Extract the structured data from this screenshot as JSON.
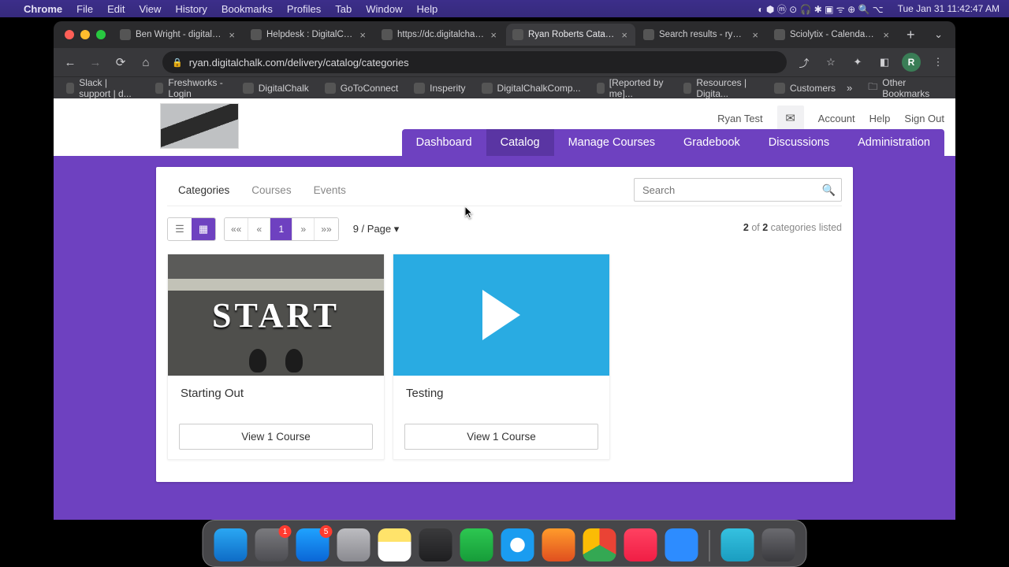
{
  "menubar": {
    "app": "Chrome",
    "items": [
      "File",
      "Edit",
      "View",
      "History",
      "Bookmarks",
      "Profiles",
      "Tab",
      "Window",
      "Help"
    ],
    "clock": "Tue Jan 31  11:42:47 AM"
  },
  "browser": {
    "tabs": [
      {
        "title": "Ben Wright - digitalchalk",
        "active": false,
        "fc": "fc-slack"
      },
      {
        "title": "Helpdesk : DigitalChalk",
        "active": false,
        "fc": "fc-dc"
      },
      {
        "title": "https://dc.digitalchalk.co",
        "active": false,
        "fc": "fc-dc"
      },
      {
        "title": "Ryan Roberts Catalog",
        "active": true,
        "fc": "fc-dc"
      },
      {
        "title": "Search results - ryan.rol",
        "active": false,
        "fc": "fc-gm"
      },
      {
        "title": "Sciolytix - Calendar - Ja",
        "active": false,
        "fc": "fc-gc"
      }
    ],
    "url": "ryan.digitalchalk.com/delivery/catalog/categories",
    "avatar": "R",
    "bookmarks": [
      {
        "label": "Slack | support | d...",
        "fc": "fc-slack"
      },
      {
        "label": "Freshworks - Login",
        "fc": "fc-fw"
      },
      {
        "label": "DigitalChalk",
        "fc": "fc-dc"
      },
      {
        "label": "GoToConnect",
        "fc": "fc-gtc"
      },
      {
        "label": "Insperity",
        "fc": "fc-ins"
      },
      {
        "label": "DigitalChalkComp...",
        "fc": "fc-yt"
      },
      {
        "label": "[Reported by me]...",
        "fc": "fc-rep"
      },
      {
        "label": "Resources | Digita...",
        "fc": "fc-res"
      },
      {
        "label": "Customers",
        "fc": "fc-cus"
      }
    ],
    "other_bookmarks": "Other Bookmarks"
  },
  "site": {
    "user": "Ryan Test",
    "links": {
      "account": "Account",
      "help": "Help",
      "signout": "Sign Out"
    },
    "nav": [
      "Dashboard",
      "Catalog",
      "Manage Courses",
      "Gradebook",
      "Discussions",
      "Administration"
    ],
    "nav_active": 1,
    "subtabs": [
      "Categories",
      "Courses",
      "Events"
    ],
    "subtab_active": 0,
    "search_placeholder": "Search",
    "perpage": "9 / Page",
    "count": {
      "shown": "2",
      "total": "2",
      "suffix": "categories listed"
    },
    "pagination": {
      "current": "1"
    },
    "cards": [
      {
        "title": "Starting Out",
        "button": "View 1 Course",
        "kind": "start",
        "start_text": "START"
      },
      {
        "title": "Testing",
        "button": "View 1 Course",
        "kind": "play"
      }
    ]
  },
  "dock": {
    "items": [
      {
        "name": "finder",
        "bg": "linear-gradient(#2aa7f3,#0e6cc6)"
      },
      {
        "name": "settings",
        "bg": "linear-gradient(#7a7a7e,#4d4d52)",
        "badge": "1"
      },
      {
        "name": "app-store",
        "bg": "linear-gradient(#1fa2ff,#0a66d6)",
        "badge": "5"
      },
      {
        "name": "launchpad",
        "bg": "linear-gradient(#bcbcc0,#8a8a90)"
      },
      {
        "name": "notes",
        "bg": "linear-gradient(#ffe36a 40%,#fff 40%)"
      },
      {
        "name": "calculator",
        "bg": "linear-gradient(#3a3a3c,#1e1e20)"
      },
      {
        "name": "numbers",
        "bg": "linear-gradient(#2dc751,#169c39)"
      },
      {
        "name": "safari",
        "bg": "radial-gradient(circle,#fff 30%,#1a9cf0 32%)"
      },
      {
        "name": "firefox",
        "bg": "linear-gradient(#ff9b2b,#e04f1f)"
      },
      {
        "name": "chrome",
        "bg": "conic-gradient(#ea4335 0 120deg,#34a853 120deg 240deg,#fbbc05 240deg 360deg)"
      },
      {
        "name": "music",
        "bg": "linear-gradient(#ff4161,#f01e45)"
      },
      {
        "name": "zoom",
        "bg": "#2d8cff"
      }
    ],
    "right": [
      {
        "name": "downloads",
        "bg": "linear-gradient(#35c1e0,#1a9dc0)"
      },
      {
        "name": "trash",
        "bg": "linear-gradient(#6a6a6f,#3a3a3e)"
      }
    ]
  }
}
